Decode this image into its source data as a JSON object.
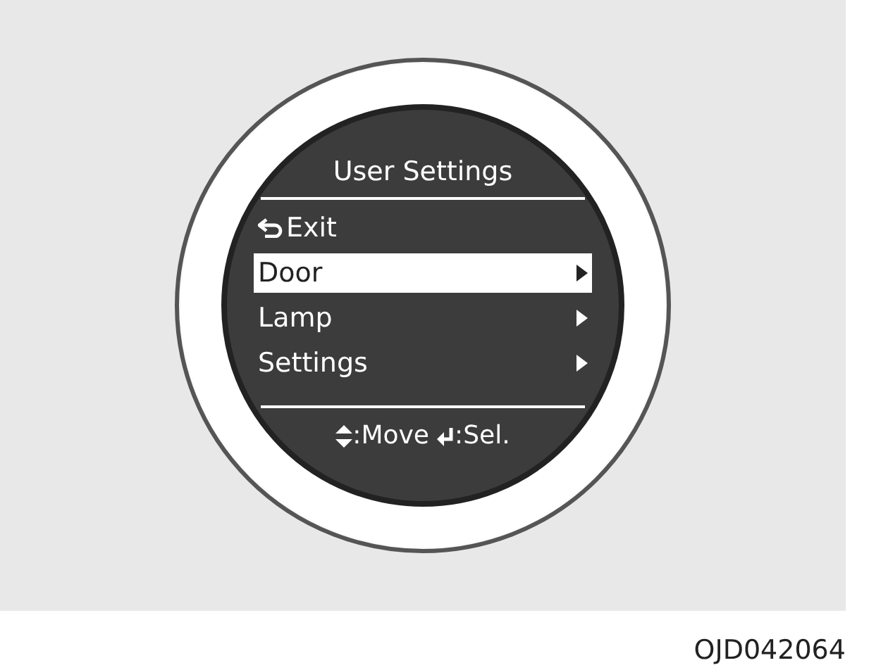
{
  "display": {
    "title": "User Settings",
    "menu": [
      {
        "label": "Exit",
        "kind": "back",
        "selected": false
      },
      {
        "label": "Door",
        "kind": "submenu",
        "selected": true
      },
      {
        "label": "Lamp",
        "kind": "submenu",
        "selected": false
      },
      {
        "label": "Settings",
        "kind": "submenu",
        "selected": false
      }
    ],
    "hints": [
      {
        "kind": "move",
        "label": ":Move"
      },
      {
        "kind": "select",
        "label": ":Sel."
      }
    ]
  },
  "figure_code": "OJD042064"
}
